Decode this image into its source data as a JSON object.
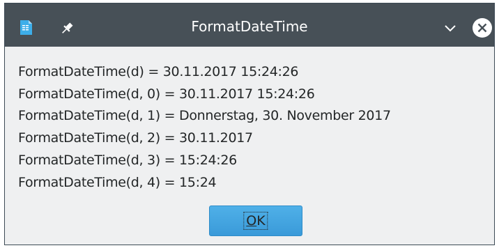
{
  "window": {
    "title": "FormatDateTime"
  },
  "titlebar": {
    "icons": {
      "app": "document-icon",
      "pin": "pin-icon",
      "minimize": "chevron-down-icon",
      "close": "close-icon"
    }
  },
  "message": {
    "lines": [
      "FormatDateTime(d) = 30.11.2017 15:24:26",
      "FormatDateTime(d, 0) = 30.11.2017 15:24:26",
      "FormatDateTime(d, 1) = Donnerstag, 30. November 2017",
      "FormatDateTime(d, 2) = 30.11.2017",
      "FormatDateTime(d, 3) = 15:24:26",
      "FormatDateTime(d, 4) = 15:24"
    ]
  },
  "buttons": {
    "ok_mnemonic": "O",
    "ok_rest": "K"
  },
  "colors": {
    "titlebar": "#475057",
    "window_bg": "#eff0f1",
    "button_accent": "#3daee9",
    "text": "#232627"
  }
}
